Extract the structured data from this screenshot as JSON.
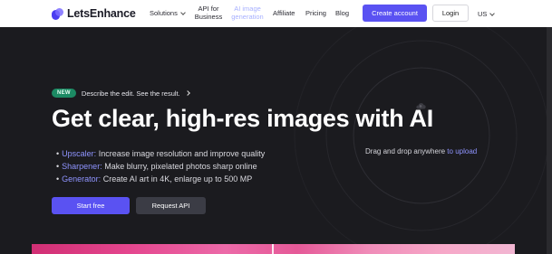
{
  "header": {
    "logo_text": "LetsEnhance",
    "nav": {
      "solutions": "Solutions",
      "api_line1": "API for",
      "api_line2": "Business",
      "ai_line1": "AI image",
      "ai_line2": "generation",
      "affiliate": "Affiliate",
      "pricing": "Pricing",
      "blog": "Blog"
    },
    "create_account": "Create account",
    "login": "Login",
    "language": "US"
  },
  "hero": {
    "badge": "NEW",
    "announcement": "Describe the edit. See the result.",
    "title": "Get clear, high-res images with AI",
    "features": [
      {
        "name": "Upscaler:",
        "text": "Increase image resolution and improve quality"
      },
      {
        "name": "Sharpener:",
        "text": "Make blurry, pixelated photos sharp online"
      },
      {
        "name": "Generator:",
        "text": "Create AI art in 4K, enlarge up to 500 MP"
      }
    ],
    "start_button": "Start free",
    "request_button": "Request API"
  },
  "dropzone": {
    "text": "Drag and drop anywhere",
    "link": "to upload"
  },
  "colors": {
    "accent": "#5a52f2",
    "feature_highlight": "#8f94ff",
    "badge_green": "#1c8a63",
    "background": "#1b1b1f"
  },
  "icons": [
    "logo-mark",
    "chevron-down-icon",
    "chevron-right-icon",
    "upload-cloud-icon"
  ]
}
